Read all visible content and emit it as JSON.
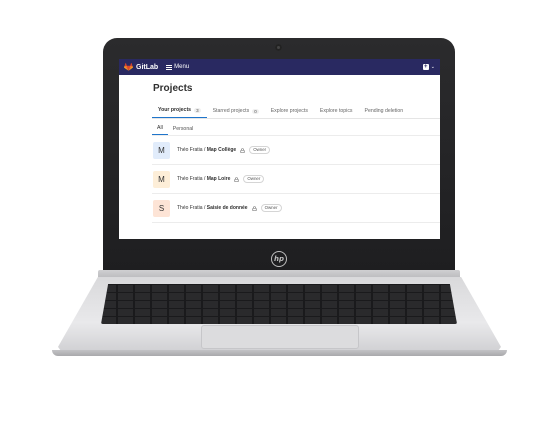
{
  "topbar": {
    "brand": "GitLab",
    "menu_label": "Menu",
    "plus_symbol": "+",
    "chevron": "⌄"
  },
  "page": {
    "title": "Projects"
  },
  "tabs": [
    {
      "label": "Your projects",
      "count": "3",
      "active": true
    },
    {
      "label": "Starred projects",
      "count": "0",
      "active": false
    },
    {
      "label": "Explore projects",
      "active": false
    },
    {
      "label": "Explore topics",
      "active": false
    },
    {
      "label": "Pending deletion",
      "active": false
    }
  ],
  "subtabs": [
    {
      "label": "All",
      "active": true
    },
    {
      "label": "Personal",
      "active": false
    }
  ],
  "projects": [
    {
      "initial": "M",
      "namespace": "Théo Fratia / ",
      "name": "Map Collège",
      "role": "Owner",
      "avatar_color": "#e1ecfb"
    },
    {
      "initial": "M",
      "namespace": "Théo Fratia / ",
      "name": "Map Loire",
      "role": "Owner",
      "avatar_color": "#fdeed8"
    },
    {
      "initial": "S",
      "namespace": "Théo Fratia / ",
      "name": "Saisie de donnée",
      "role": "Owner",
      "avatar_color": "#fde4d6"
    }
  ],
  "colors": {
    "topbar": "#292961",
    "active_tab": "#1f75cb",
    "gitlab_orange": "#e24329"
  },
  "icons": {
    "logo": "gitlab-fox-icon",
    "menu": "hamburger-icon",
    "lock": "lock-icon",
    "laptop_logo": "hp-logo"
  },
  "device": {
    "laptop_logo_text": "hp"
  }
}
